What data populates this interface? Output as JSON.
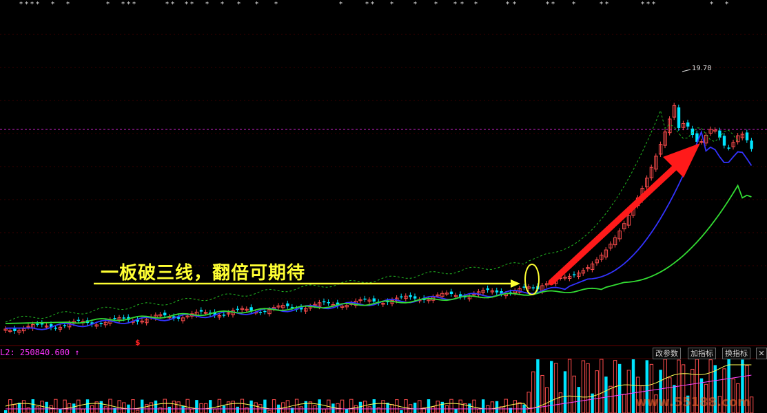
{
  "annotation": {
    "text": "一板破三线，翻倍可期待"
  },
  "peak_label": "19.78",
  "marker_symbol": "$",
  "volume_indicator": "L2: 250840.600 ↑",
  "toolbar": {
    "modify_params": "改参数",
    "add_indicator": "加指标",
    "switch_indicator": "换指标",
    "close": "✕"
  },
  "watermark": "www.55188.com",
  "colors": {
    "background": "#000000",
    "up_candle": "#ff4d4d",
    "down_candle": "#00e5ff",
    "ma_short": "#ffff55",
    "ma_mid": "#3333ff",
    "ma_long": "#33dd33",
    "boll_upper": "#22bb22",
    "annotation": "#ffff33",
    "arrow": "#ff1a1a",
    "volume_indicator": "#ff33ff"
  },
  "chart_data": {
    "type": "candlestick",
    "panels": [
      "price",
      "volume"
    ],
    "price": {
      "peak": 19.78,
      "candles_summary": "long flat consolidation followed by a limit-up breakout and a steep rally to a peak of 19.78, then a pullback",
      "moving_averages": [
        {
          "color": "#3333ff"
        },
        {
          "color": "#33dd33"
        },
        {
          "color": "#22bb22",
          "style": "dashed"
        }
      ]
    },
    "volume": {
      "indicator_value": 250840.6,
      "indicator_direction": "up"
    }
  }
}
